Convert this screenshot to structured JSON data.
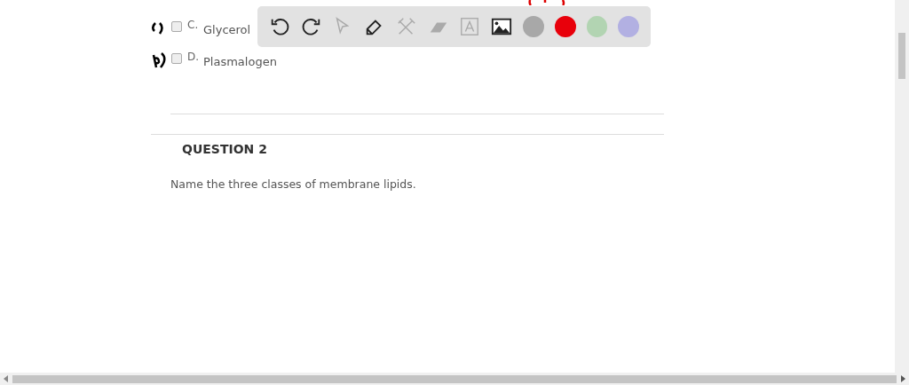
{
  "options": [
    {
      "letter": "C.",
      "text": "Glycerol",
      "checked": false
    },
    {
      "letter": "D.",
      "text": "Plasmalogen",
      "checked": false
    }
  ],
  "question": {
    "heading": "QUESTION 2",
    "prompt": "Name the three classes of membrane lipids."
  },
  "toolbar": [
    {
      "kind": "undo",
      "disabled": false
    },
    {
      "kind": "redo",
      "disabled": false
    },
    {
      "kind": "pointer",
      "disabled": true
    },
    {
      "kind": "pen",
      "disabled": false
    },
    {
      "kind": "tools",
      "disabled": true
    },
    {
      "kind": "eraser",
      "disabled": true
    },
    {
      "kind": "text",
      "disabled": true
    },
    {
      "kind": "image",
      "disabled": false
    },
    {
      "kind": "color",
      "color": "#a8a8a8"
    },
    {
      "kind": "color",
      "color": "#e8000b"
    },
    {
      "kind": "color",
      "color": "#b2d4b2"
    },
    {
      "kind": "color",
      "color": "#b2b0e2"
    }
  ]
}
